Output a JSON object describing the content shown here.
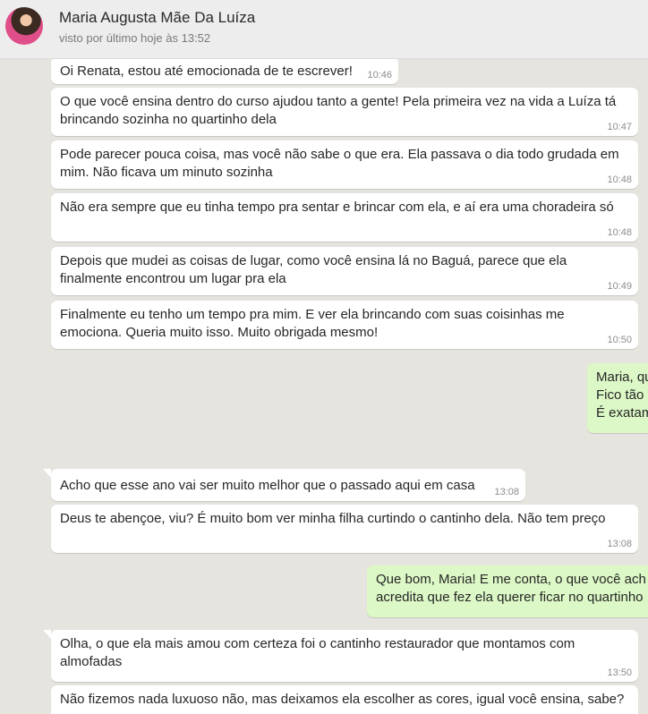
{
  "header": {
    "contact_name": "Maria Augusta Mãe Da Luíza",
    "last_seen": "visto por último hoje às 13:52"
  },
  "messages": [
    {
      "text": "Oi Renata, estou até emocionada de te escrever!",
      "time": "10:46",
      "direction": "in"
    },
    {
      "text": "O que você ensina dentro do curso ajudou tanto a gente! Pela primeira vez na vida a Luíza tá\nbrincando sozinha no quartinho dela",
      "time": "10:47",
      "direction": "in"
    },
    {
      "text": "Pode parecer pouca coisa, mas você não sabe o que era. Ela passava o dia todo grudada em\nmim. Não ficava um minuto sozinha",
      "time": "10:48",
      "direction": "in"
    },
    {
      "text": "Não era sempre que eu tinha tempo pra sentar e brincar com ela, e aí era uma choradeira só",
      "time": "10:48",
      "direction": "in"
    },
    {
      "text": "Depois que mudei as coisas de lugar, como você ensina lá no Baguá, parece que ela\nfinalmente encontrou um lugar pra ela",
      "time": "10:49",
      "direction": "in"
    },
    {
      "text": "Finalmente eu tenho um tempo pra mim. E ver ela brincando com suas coisinhas me\nemociona. Queria muito isso. Muito obrigada mesmo!",
      "time": "10:50",
      "direction": "in"
    },
    {
      "text": "Maria, qu\nFico tão\nÉ exatam",
      "time": "",
      "direction": "out"
    },
    {
      "text": "Acho que esse ano vai ser muito melhor que o passado aqui em casa",
      "time": "13:08",
      "direction": "in"
    },
    {
      "text": "Deus te abençoe, viu? É muito bom ver minha filha curtindo o cantinho dela. Não tem preço",
      "time": "13:08",
      "direction": "in"
    },
    {
      "text": "Que bom, Maria! E me conta, o que você ach\nacredita que fez ela querer ficar no quartinho",
      "time": "",
      "direction": "out"
    },
    {
      "text": "Olha, o que ela mais amou com certeza foi o cantinho restaurador que montamos com\nalmofadas",
      "time": "13:50",
      "direction": "in"
    },
    {
      "text": "Não fizemos nada luxuoso não, mas deixamos ela escolher as cores, igual você ensina, sabe?",
      "time": "",
      "direction": "in"
    }
  ]
}
